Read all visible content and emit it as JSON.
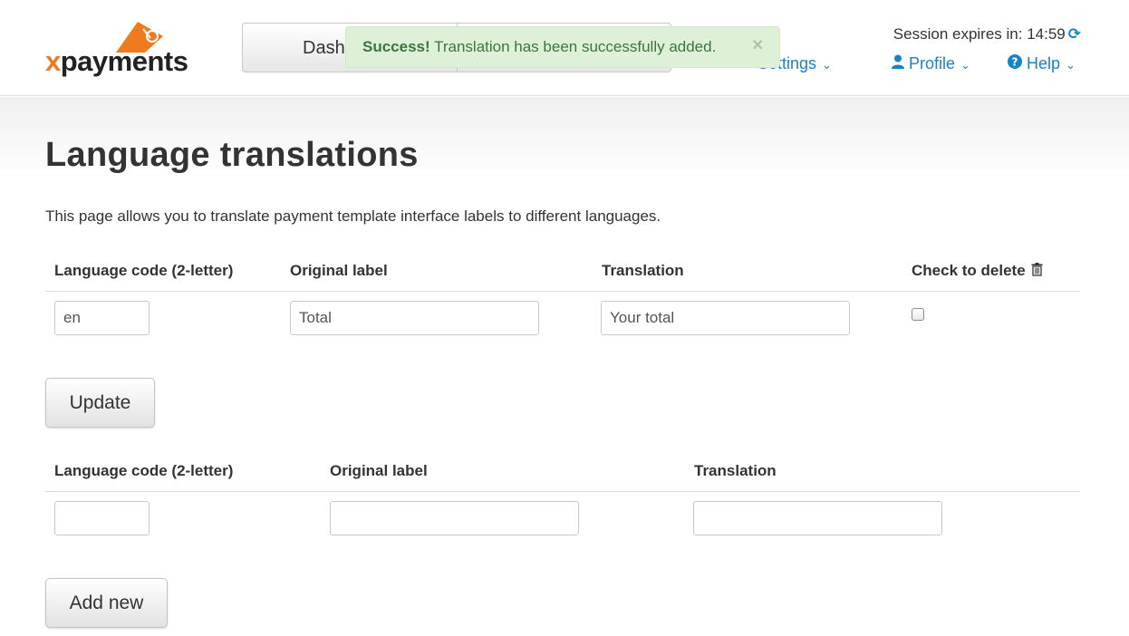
{
  "header": {
    "logo": {
      "text_prefix": "x",
      "text_rest": "payments"
    },
    "nav_buttons": [
      "Dash",
      ""
    ],
    "alert": {
      "strong": "Success!",
      "message": " Translation has been successfully added.",
      "close": "×"
    },
    "session": {
      "label": "Session expires in: 14:59",
      "refresh_icon": "refresh-icon"
    },
    "menu": {
      "settings": "Settings",
      "profile": "Profile",
      "help": "Help"
    }
  },
  "main": {
    "title": "Language translations",
    "intro": "This page allows you to translate payment template interface labels to different languages.",
    "existing": {
      "columns": [
        "Language code (2-letter)",
        "Original label",
        "Translation",
        "Check to delete"
      ],
      "row": {
        "code": "en",
        "original": "Total",
        "translation": "Your total",
        "checked": false
      }
    },
    "update_label": "Update",
    "new": {
      "columns": [
        "Language code (2-letter)",
        "Original label",
        "Translation"
      ],
      "row": {
        "code": "",
        "original": "",
        "translation": ""
      }
    },
    "add_label": "Add new"
  },
  "colors": {
    "accent": "#1a82c8",
    "brand_orange": "#f07a1e",
    "success_bg": "#dff0d8",
    "success_text": "#3c763d"
  }
}
